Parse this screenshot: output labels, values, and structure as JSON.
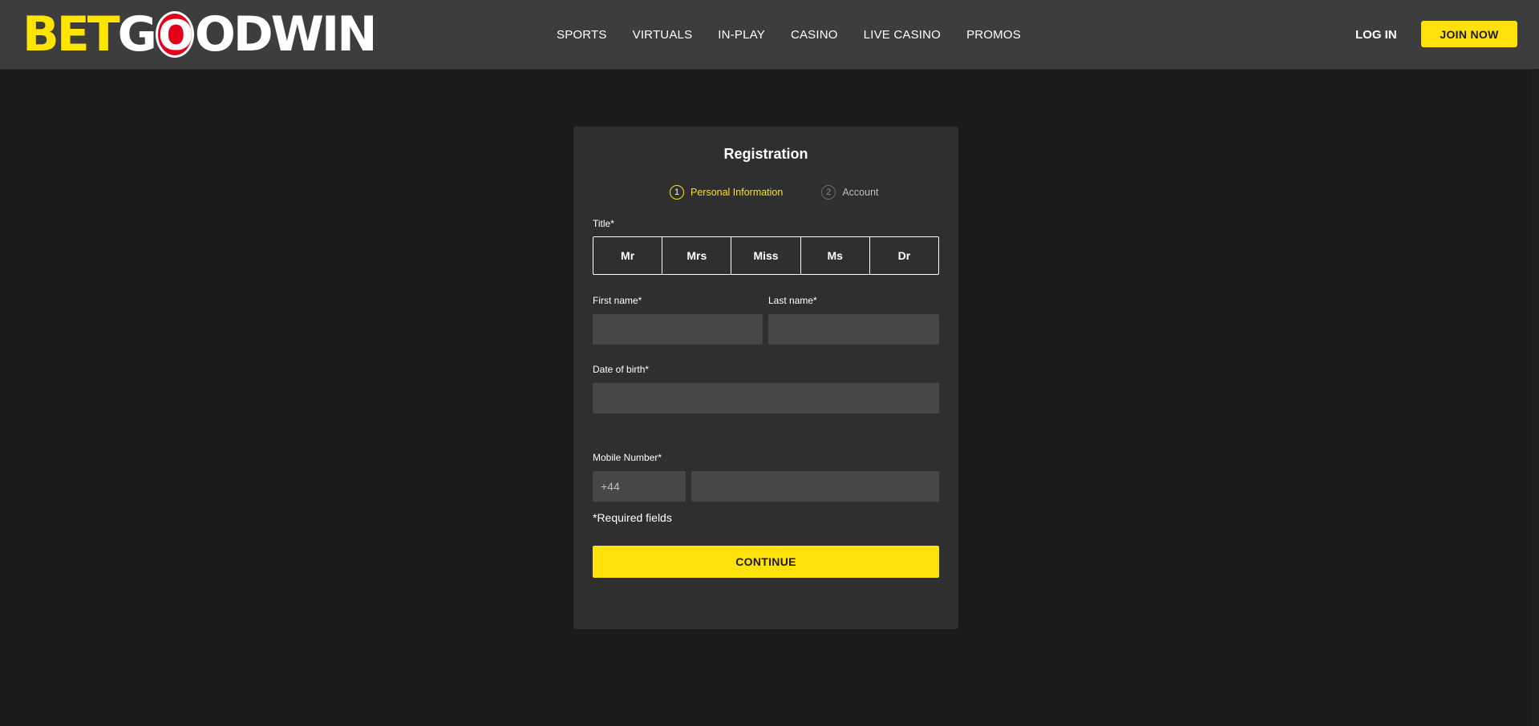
{
  "header": {
    "logo": {
      "part1": "BET",
      "part2": "G",
      "part_o": "O",
      "part3": "ODWIN"
    },
    "nav": [
      "SPORTS",
      "VIRTUALS",
      "IN-PLAY",
      "CASINO",
      "LIVE CASINO",
      "PROMOS"
    ],
    "login_label": "LOG IN",
    "join_label": "JOIN NOW"
  },
  "form": {
    "title": "Registration",
    "steps": [
      {
        "number": "1",
        "label": "Personal Information",
        "state": "active"
      },
      {
        "number": "2",
        "label": "Account",
        "state": "inactive"
      }
    ],
    "title_label": "Title*",
    "title_options": [
      "Mr",
      "Mrs",
      "Miss",
      "Ms",
      "Dr"
    ],
    "first_name_label": "First name*",
    "last_name_label": "Last name*",
    "dob_label": "Date of birth*",
    "mobile_label": "Mobile Number*",
    "mobile_prefix": "+44",
    "required_note": "*Required fields",
    "continue_label": "CONTINUE"
  },
  "colors": {
    "accent": "#ffe10c",
    "logo_red": "#e3001b",
    "header_bg": "#3d3d3d",
    "page_bg": "#1b1b1b",
    "card_bg": "#2f2f2f",
    "input_bg": "#474747"
  }
}
